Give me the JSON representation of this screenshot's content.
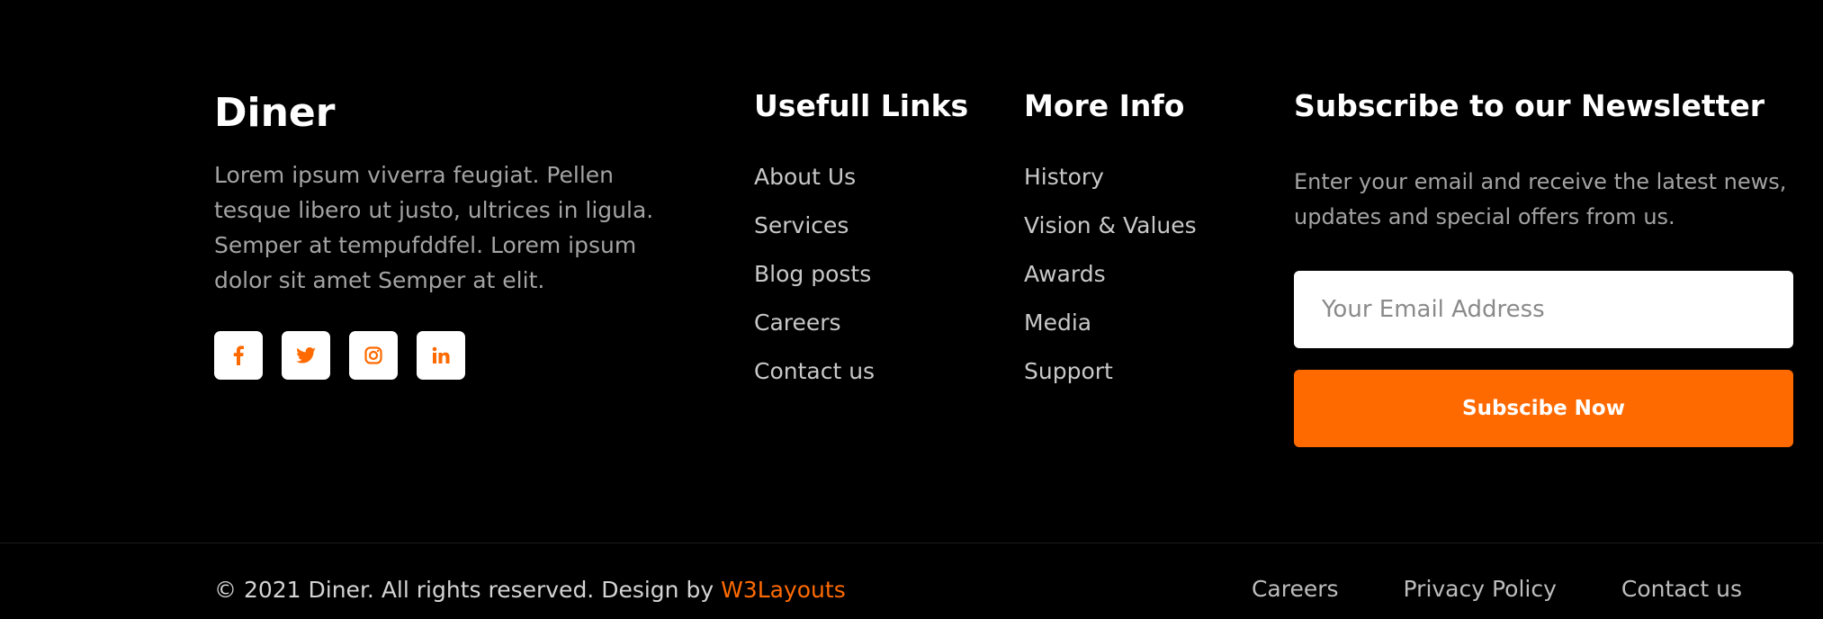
{
  "brand": {
    "title": "Diner",
    "description": "Lorem ipsum viverra feugiat. Pellen tesque libero ut justo, ultrices in ligula. Semper at tempufddfel. Lorem ipsum dolor sit amet Semper at elit."
  },
  "social": [
    {
      "name": "facebook",
      "icon": "facebook-icon"
    },
    {
      "name": "twitter",
      "icon": "twitter-icon"
    },
    {
      "name": "instagram",
      "icon": "instagram-icon"
    },
    {
      "name": "linkedin",
      "icon": "linkedin-icon"
    }
  ],
  "useful_links": {
    "heading": "Usefull Links",
    "items": [
      "About Us",
      "Services",
      "Blog posts",
      "Careers",
      "Contact us"
    ]
  },
  "more_info": {
    "heading": "More Info",
    "items": [
      "History",
      "Vision & Values",
      "Awards",
      "Media",
      "Support"
    ]
  },
  "newsletter": {
    "heading": "Subscribe to our Newsletter",
    "description": "Enter your email and receive the latest news, updates and special offers from us.",
    "email_placeholder": "Your Email Address",
    "button_label": "Subscibe Now"
  },
  "footer": {
    "copyright_text": "© 2021 Diner. All rights reserved. Design by ",
    "designer_link": "W3Layouts",
    "nav": [
      "Careers",
      "Privacy Policy",
      "Contact us"
    ]
  },
  "colors": {
    "background": "#000000",
    "accent": "#ff6a00",
    "heading": "#ffffff",
    "body_text": "#a3a3a3"
  }
}
